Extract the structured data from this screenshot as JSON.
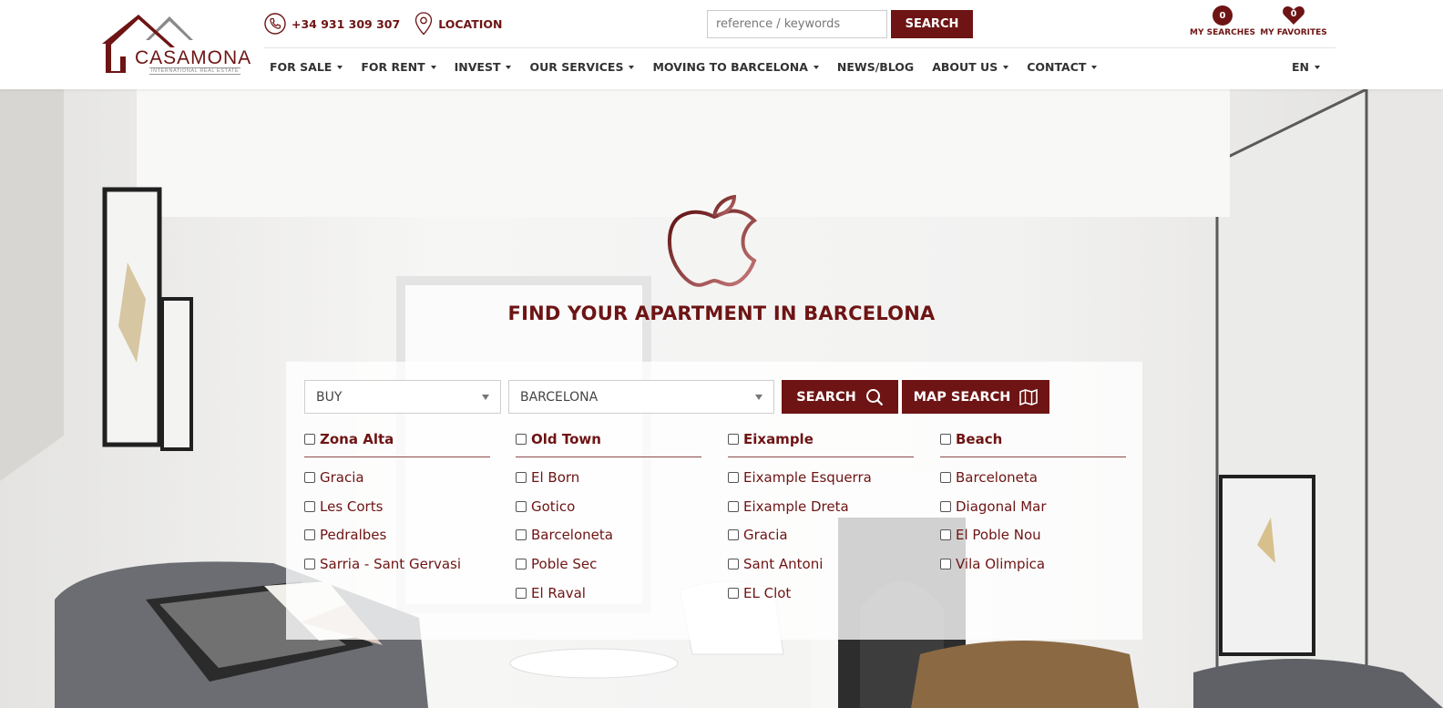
{
  "brand": {
    "logo_text": "CASAMONA",
    "logo_subtext": "INTERNATIONAL REAL ESTATE"
  },
  "contact": {
    "phone": "+34 931 309 307",
    "phone_icon": "phone-icon",
    "location_label": "LOCATION",
    "location_icon": "location-pin-icon"
  },
  "top_search": {
    "placeholder": "reference / keywords",
    "value": "",
    "button_label": "SEARCH"
  },
  "user_links": {
    "searches": {
      "count": "0",
      "label": "MY SEARCHES"
    },
    "favorites": {
      "count": "0",
      "label": "MY FAVORITES",
      "icon": "heart-icon"
    }
  },
  "nav": {
    "items": [
      {
        "label": "FOR SALE",
        "dropdown": true
      },
      {
        "label": "FOR RENT",
        "dropdown": true
      },
      {
        "label": "INVEST",
        "dropdown": true
      },
      {
        "label": "OUR SERVICES",
        "dropdown": true
      },
      {
        "label": "MOVING TO BARCELONA",
        "dropdown": true
      },
      {
        "label": "NEWS/BLOG",
        "dropdown": false
      },
      {
        "label": "ABOUT US",
        "dropdown": true
      },
      {
        "label": "CONTACT",
        "dropdown": true
      }
    ],
    "language": "EN"
  },
  "hero": {
    "icon": "apple-icon",
    "title": "FIND YOUR APARTMENT IN BARCELONA"
  },
  "search_form": {
    "operation": "BUY",
    "city": "BARCELONA",
    "search_label": "SEARCH",
    "search_icon": "search-icon",
    "map_search_label": "MAP SEARCH",
    "map_icon": "map-icon"
  },
  "zones": [
    {
      "name": "Zona Alta",
      "areas": [
        "Gracia",
        "Les Corts",
        "Pedralbes",
        "Sarria - Sant Gervasi"
      ]
    },
    {
      "name": "Old Town",
      "areas": [
        "El Born",
        "Gotico",
        "Barceloneta",
        "Poble Sec",
        "El Raval"
      ]
    },
    {
      "name": "Eixample",
      "areas": [
        "Eixample Esquerra",
        "Eixample Dreta",
        "Gracia",
        "Sant Antoni",
        "EL Clot"
      ]
    },
    {
      "name": "Beach",
      "areas": [
        "Barceloneta",
        "Diagonal Mar",
        "El Poble Nou",
        "Vila Olimpica"
      ]
    }
  ],
  "colors": {
    "brand": "#6e1414",
    "text_dark": "#333333"
  }
}
